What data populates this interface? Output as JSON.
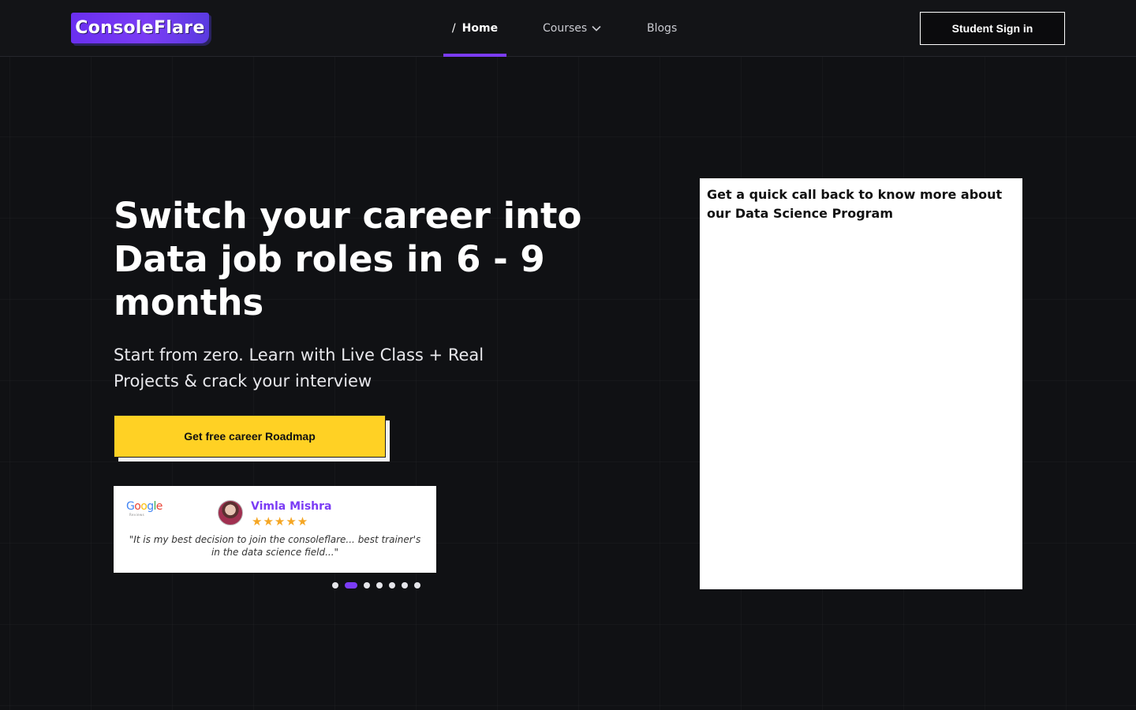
{
  "header": {
    "logo_text": "ConsoleFlare",
    "nav": {
      "home_slash": "/",
      "home_label": "Home",
      "courses_label": "Courses",
      "blogs_label": "Blogs"
    },
    "signin_label": "Student Sign in"
  },
  "hero": {
    "title": "Switch your career into Data job roles in 6 - 9 months",
    "subtitle": "Start from zero. Learn with Live Class + Real Projects & crack your interview",
    "cta_label": "Get free career Roadmap"
  },
  "review": {
    "source_logo": "Google",
    "source_sub": "Reviews",
    "name": "Vimla Mishra",
    "rating": 5,
    "stars": "★★★★★",
    "text": "\"It is my best decision to join the consoleflare... best trainer's in the data science field...\"",
    "slide_count": 7,
    "active_slide": 2
  },
  "form": {
    "title": "Get a quick call back to know more about our Data Science Program"
  },
  "colors": {
    "background": "#101114",
    "accent_purple": "#7b3cf5",
    "cta_yellow": "#ffd124",
    "star_orange": "#f5a623"
  }
}
